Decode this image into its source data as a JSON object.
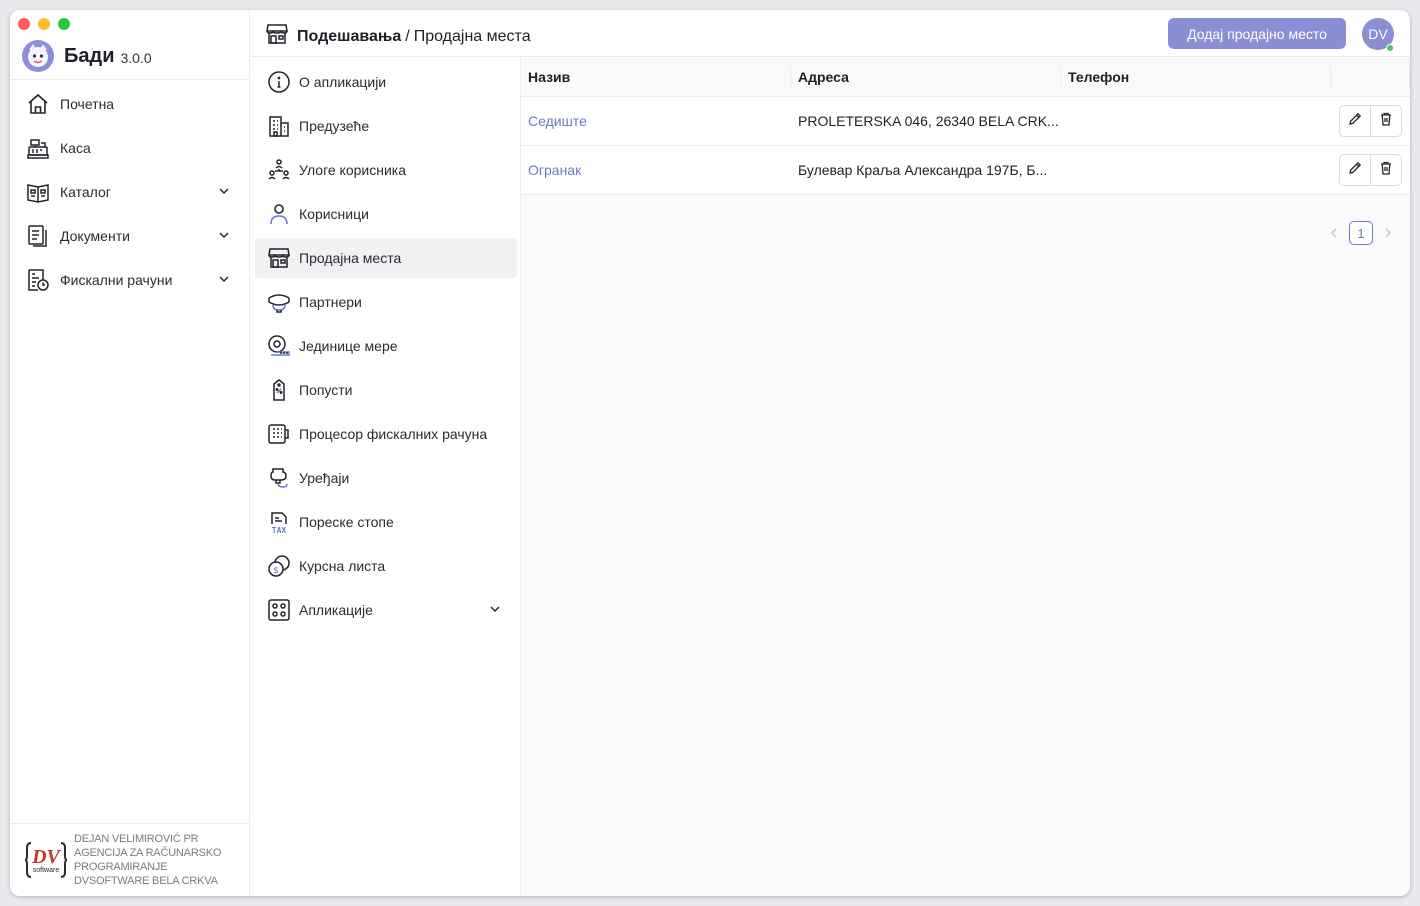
{
  "app": {
    "name": "Бади",
    "version": "3.0.0"
  },
  "colors": {
    "accent": "#8a8ed3",
    "link": "#6c78c9",
    "close": "#ff5f57",
    "minimize": "#febc2e",
    "maximize": "#28c840",
    "online": "#4fc36e"
  },
  "sidebar": {
    "items": [
      {
        "label": "Почетна",
        "icon": "home-icon"
      },
      {
        "label": "Каса",
        "icon": "cash-register-icon"
      },
      {
        "label": "Каталог",
        "icon": "catalog-icon",
        "expandable": true
      },
      {
        "label": "Документи",
        "icon": "documents-icon",
        "expandable": true
      },
      {
        "label": "Фискални рачуни",
        "icon": "fiscal-receipt-icon",
        "expandable": true
      }
    ]
  },
  "footer": {
    "logo_text": "DV software",
    "lines": [
      "DEJAN VELIMIROVIĆ PR",
      "AGENCIJA ZA RAČUNARSKO",
      "PROGRAMIRANJE",
      "DVSOFTWARE BELA CRKVA"
    ]
  },
  "header": {
    "breadcrumb_root": "Подешавања",
    "breadcrumb_sep": "/",
    "breadcrumb_current": "Продајна места",
    "add_button": "Додај продајно место",
    "avatar_initials": "DV"
  },
  "settings_nav": {
    "items": [
      {
        "label": "О апликацији",
        "icon": "info-icon"
      },
      {
        "label": "Предузеће",
        "icon": "building-icon"
      },
      {
        "label": "Улоге корисника",
        "icon": "user-roles-icon"
      },
      {
        "label": "Корисници",
        "icon": "user-icon"
      },
      {
        "label": "Продајна места",
        "icon": "store-icon",
        "active": true
      },
      {
        "label": "Партнери",
        "icon": "handshake-icon"
      },
      {
        "label": "Јединице мере",
        "icon": "measure-tape-icon"
      },
      {
        "label": "Попусти",
        "icon": "discount-tag-icon"
      },
      {
        "label": "Процесор фискалних рачуна",
        "icon": "fiscal-processor-icon"
      },
      {
        "label": "Уређаји",
        "icon": "device-icon"
      },
      {
        "label": "Пореске стопе",
        "icon": "tax-icon"
      },
      {
        "label": "Курсна листа",
        "icon": "exchange-rate-icon"
      },
      {
        "label": "Апликације",
        "icon": "apps-icon",
        "expandable": true
      }
    ]
  },
  "table": {
    "columns": [
      "Назив",
      "Адреса",
      "Телефон",
      ""
    ],
    "rows": [
      {
        "name": "Седиште",
        "address": "PROLETERSKA 046, 26340 BELA CRK...",
        "phone": ""
      },
      {
        "name": "Огранак",
        "address": "Булевар Краља Александра 197Б, Б...",
        "phone": ""
      }
    ]
  },
  "pagination": {
    "current_page": "1"
  }
}
